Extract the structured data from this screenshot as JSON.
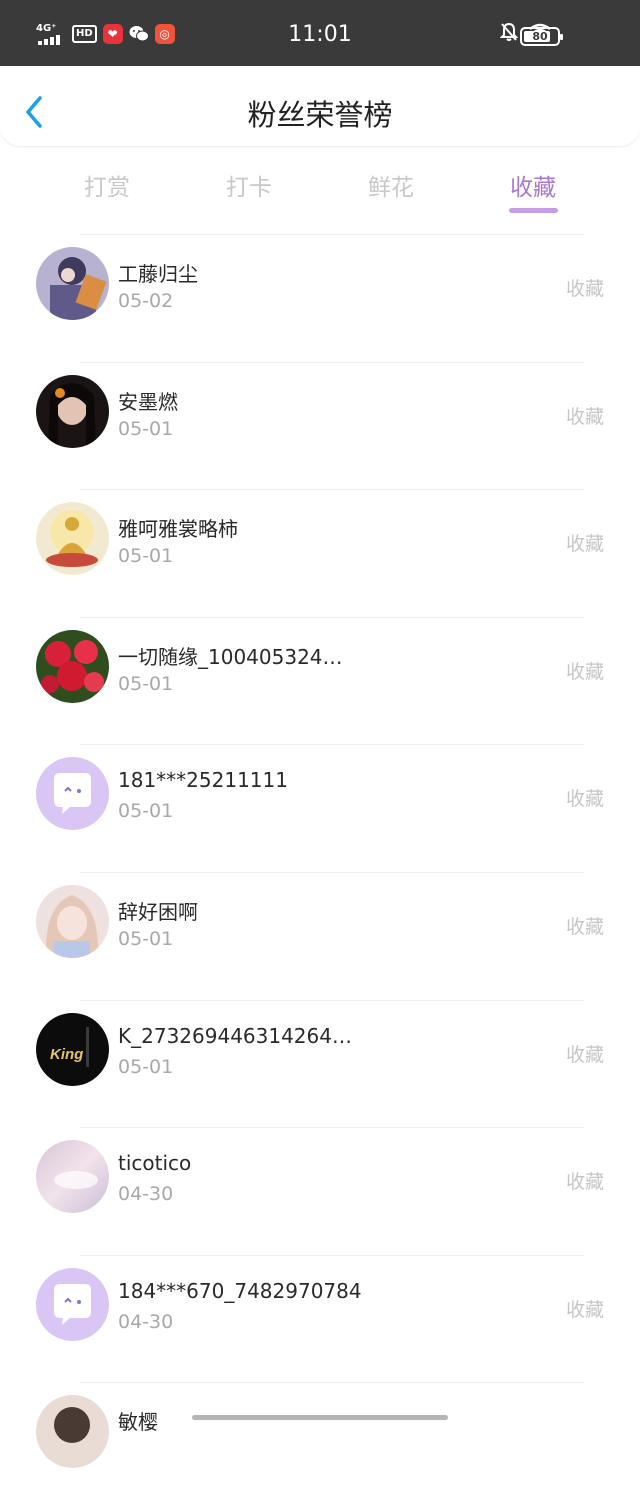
{
  "status_bar": {
    "network": "4G⁺",
    "hd": "HD",
    "time": "11:01",
    "battery": "80",
    "battery_level": 0.8
  },
  "header": {
    "title": "粉丝荣誉榜"
  },
  "tabs": [
    {
      "label": "打赏",
      "active": false
    },
    {
      "label": "打卡",
      "active": false
    },
    {
      "label": "鲜花",
      "active": false
    },
    {
      "label": "收藏",
      "active": true
    }
  ],
  "colors": {
    "accent": "#a978d2",
    "indicator": "#c69ee8",
    "back": "#1aa0e8"
  },
  "fans": [
    {
      "name": "工藤归尘",
      "date": "05-02",
      "action": "收藏",
      "avatar": "anime-boy"
    },
    {
      "name": "安墨燃",
      "date": "05-01",
      "action": "收藏",
      "avatar": "dark-portrait"
    },
    {
      "name": "雅呵雅裳略柿",
      "date": "05-01",
      "action": "收藏",
      "avatar": "buddha"
    },
    {
      "name": "一切随缘_100405324…",
      "date": "05-01",
      "action": "收藏",
      "avatar": "red-flowers"
    },
    {
      "name": "181***25211111",
      "date": "05-01",
      "action": "收藏",
      "avatar": "default-chat"
    },
    {
      "name": "辞好困啊",
      "date": "05-01",
      "action": "收藏",
      "avatar": "anime-girl"
    },
    {
      "name": "K_273269446314264…",
      "date": "05-01",
      "action": "收藏",
      "avatar": "king-logo"
    },
    {
      "name": "ticotico",
      "date": "04-30",
      "action": "收藏",
      "avatar": "pastel-cloud"
    },
    {
      "name": "184***670_7482970784",
      "date": "04-30",
      "action": "收藏",
      "avatar": "default-chat"
    },
    {
      "name": "敏樱",
      "date": "",
      "action": "",
      "avatar": "partial"
    }
  ],
  "avatar_text": {
    "king": "King"
  }
}
